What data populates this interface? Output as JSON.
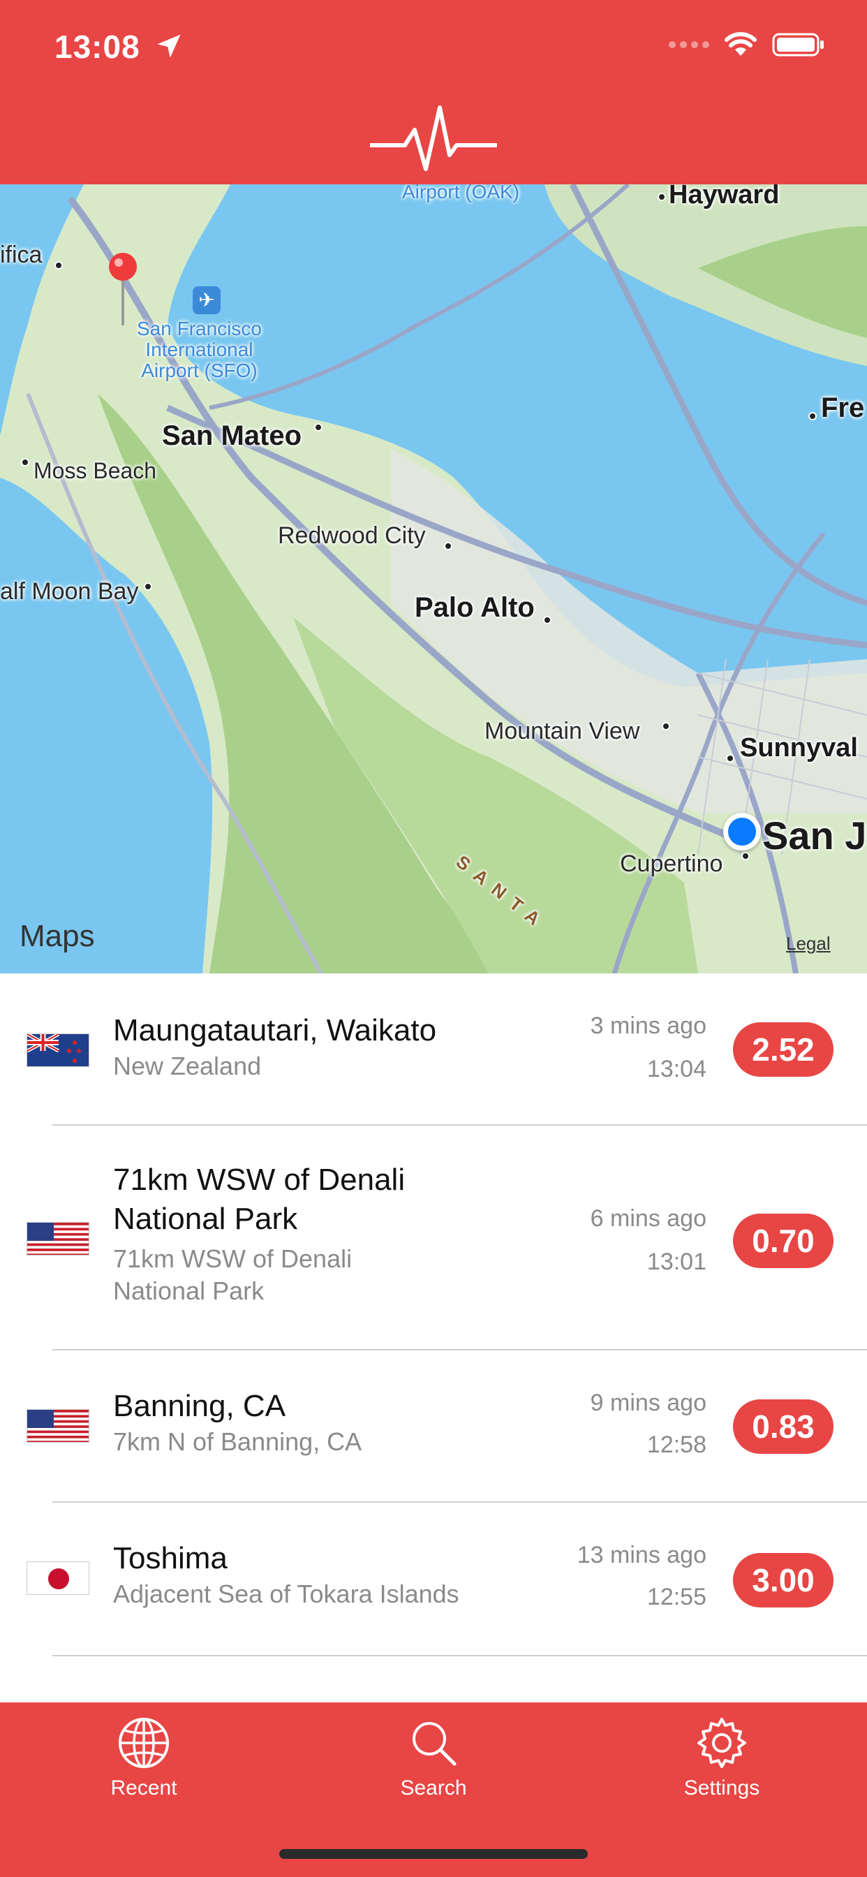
{
  "status_bar": {
    "time": "13:08",
    "icons": [
      "location-arrow-icon",
      "signal-icon",
      "wifi-icon",
      "battery-icon"
    ]
  },
  "header": {
    "logo_icon": "heartbeat-icon",
    "color": "#E84545"
  },
  "map": {
    "labels": {
      "airport_oak": "Airport (OAK)",
      "hayward": "Hayward",
      "pacifica": "ifica",
      "sfo": "San Francisco\nInternational\nAirport (SFO)",
      "fremont": "Fre",
      "san_mateo": "San Mateo",
      "moss_beach": "Moss Beach",
      "redwood_city": "Redwood City",
      "half_moon_bay": "alf Moon Bay",
      "palo_alto": "Palo Alto",
      "mountain_view": "Mountain View",
      "sunnyvale": "Sunnyval",
      "san_jose": "San J",
      "cupertino": "Cupertino",
      "santa": "SANTA"
    },
    "attribution": "Maps",
    "legal": "Legal"
  },
  "quakes": [
    {
      "flag": "nz-flag-icon",
      "title": "Maungatautari, Waikato",
      "subtitle": "New Zealand",
      "ago": "3 mins ago",
      "time": "13:04",
      "magnitude": "2.52"
    },
    {
      "flag": "us-flag-icon",
      "title": "71km WSW of Denali National Park",
      "subtitle": "71km WSW of Denali National Park",
      "ago": "6 mins ago",
      "time": "13:01",
      "magnitude": "0.70"
    },
    {
      "flag": "us-flag-icon",
      "title": "Banning, CA",
      "subtitle": "7km N of Banning, CA",
      "ago": "9 mins ago",
      "time": "12:58",
      "magnitude": "0.83"
    },
    {
      "flag": "jp-flag-icon",
      "title": "Toshima",
      "subtitle": "Adjacent Sea of Tokara Islands",
      "ago": "13 mins ago",
      "time": "12:55",
      "magnitude": "3.00"
    }
  ],
  "tabbar": {
    "tabs": [
      {
        "label": "Recent",
        "icon": "globe-icon"
      },
      {
        "label": "Search",
        "icon": "search-icon"
      },
      {
        "label": "Settings",
        "icon": "gear-icon"
      }
    ]
  }
}
